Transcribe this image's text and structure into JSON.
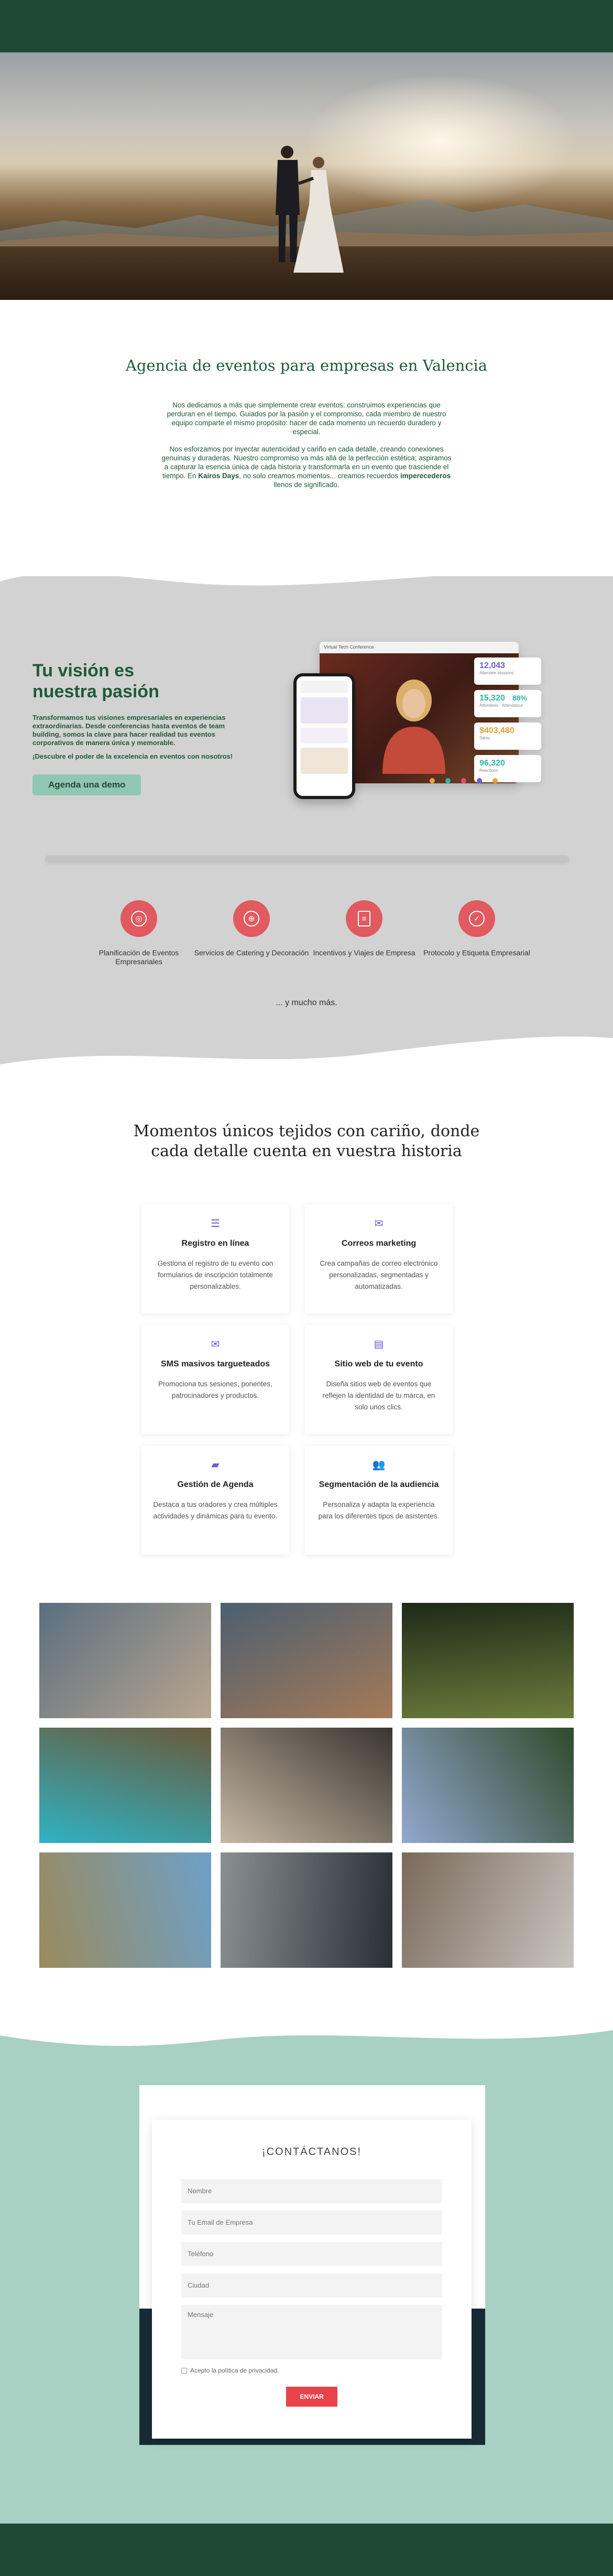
{
  "intro": {
    "title": "Agencia de eventos para empresas en Valencia",
    "p1": "Nos dedicamos a más que simplemente crear eventos; construimos experiencias que perduran en el tiempo. Guiados por la pasión y el compromiso, cada miembro de nuestro equipo comparte el mismo propósito: hacer de cada momento un recuerdo duradero y especial.",
    "p2_start": "Nos esforzamos por inyectar autenticidad y cariño en cada detalle, creando conexiones genuinas y duraderas. Nuestro compromiso va más allá de la perfección estética; aspiramos a capturar la esencia única de cada historia y transformarla en un evento que trasciende el tiempo. En ",
    "p2_brand": "Kairos Days",
    "p2_mid": ", no solo creamos momentos... creamos recuerdos ",
    "p2_bold": "imperecederos",
    "p2_end": " llenos de significado."
  },
  "vision": {
    "title_line1": "Tu visión es",
    "title_line2": "nuestra pasión",
    "body": "Transformamos tus visiones empresariales en experiencias extraordinarias. Desde conferencias hasta eventos de team building, somos la clave para hacer realidad tus eventos corporativos de manera única y memorable.",
    "tagline": "¡Descubre el poder de la excelencia en eventos con nosotros!",
    "cta": "Agenda una demo",
    "mockup": {
      "window_title": "Virtual Tech Conference",
      "stats": [
        {
          "value": "12,043",
          "label": "Attendee sessions",
          "color": "#6b5bd6"
        },
        {
          "value": "15,320",
          "label": "Attendees",
          "color": "#2fb8a8"
        },
        {
          "value": "88%",
          "label": "Attendance",
          "color": "#2fb8a8"
        },
        {
          "value": "$403,480",
          "label": "Sales",
          "color": "#e8a33a"
        },
        {
          "value": "96,320",
          "label": "Reactions",
          "color": "#2fb8a8"
        }
      ]
    }
  },
  "services": [
    {
      "label": "Planificación de Eventos Empresariales",
      "icon": "target-icon"
    },
    {
      "label": "Servicios de Catering y Decoración",
      "icon": "globe-icon"
    },
    {
      "label": "Incentivos y Viajes de Empresa",
      "icon": "document-icon"
    },
    {
      "label": "Protocolo y Etiqueta Empresarial",
      "icon": "check-icon"
    }
  ],
  "more": "... y mucho más.",
  "moments": {
    "title_line1": "Momentos únicos tejidos con cariño, donde",
    "title_line2": "cada detalle cuenta en vuestra historia",
    "features": [
      {
        "title": "Registro en línea",
        "text": "Gestiona el registro de tu evento con formularios de inscripción totalmente personalizables.",
        "icon": "list-icon"
      },
      {
        "title": "Correos marketing",
        "text": "Crea campañas de correo electrónico personalizadas, segmentadas y automatizadas.",
        "icon": "mail-open-icon"
      },
      {
        "title": "SMS masivos targueteados",
        "text": "Promociona tus sesiones, ponentes, patrocinadores y productos.",
        "icon": "envelope-icon"
      },
      {
        "title": "Sitio web de tu evento",
        "text": "Diseña sitios web de eventos que reflejen la identidad de tu marca, en solo unos clics.",
        "icon": "browser-icon"
      },
      {
        "title": "Gestión de Agenda",
        "text": "Destaca a tus oradores y crea múltiples actividades y dinámicas para tu evento.",
        "icon": "folder-icon"
      },
      {
        "title": "Segmentación de la audiencia",
        "text": "Personaliza y adapta la experiencia para los diferentes tipos de asistentes.",
        "icon": "users-icon"
      }
    ]
  },
  "gallery": [
    {
      "name": "photo-vr-group",
      "c1": "#5a6f80",
      "c2": "#b9a68e"
    },
    {
      "name": "photo-hands-together",
      "c1": "#4c5f70",
      "c2": "#a57a58"
    },
    {
      "name": "photo-lantern-forest",
      "c1": "#1e2a18",
      "c2": "#6c7b3c"
    },
    {
      "name": "photo-pool-aerial",
      "c1": "#6a5a3a",
      "c2": "#2fb2c4"
    },
    {
      "name": "photo-toast-table",
      "c1": "#3a3530",
      "c2": "#c6b8a4"
    },
    {
      "name": "photo-garden-terrace",
      "c1": "#2f4a2a",
      "c2": "#93a8d0"
    },
    {
      "name": "photo-outdoor-games",
      "c1": "#6ea0c8",
      "c2": "#9a8a5c"
    },
    {
      "name": "photo-event-hall",
      "c1": "#283036",
      "c2": "#8a8f92"
    },
    {
      "name": "photo-champagne-tables",
      "c1": "#c9c4c0",
      "c2": "#7a6a5a"
    }
  ],
  "contact": {
    "title": "¡CONTÁCTANOS!",
    "fields": {
      "name": "Nombre",
      "email": "Tu Email de Empresa",
      "phone": "Teléfono",
      "city": "Ciudad",
      "message": "Mensaje"
    },
    "privacy": "Acepto la política de privacidad.",
    "submit": "ENVIAR"
  },
  "colors": {
    "brand_green": "#1e4a33",
    "accent_teal": "#a8d0c3",
    "service_red": "#e05a5f",
    "submit_red": "#e8424b"
  }
}
